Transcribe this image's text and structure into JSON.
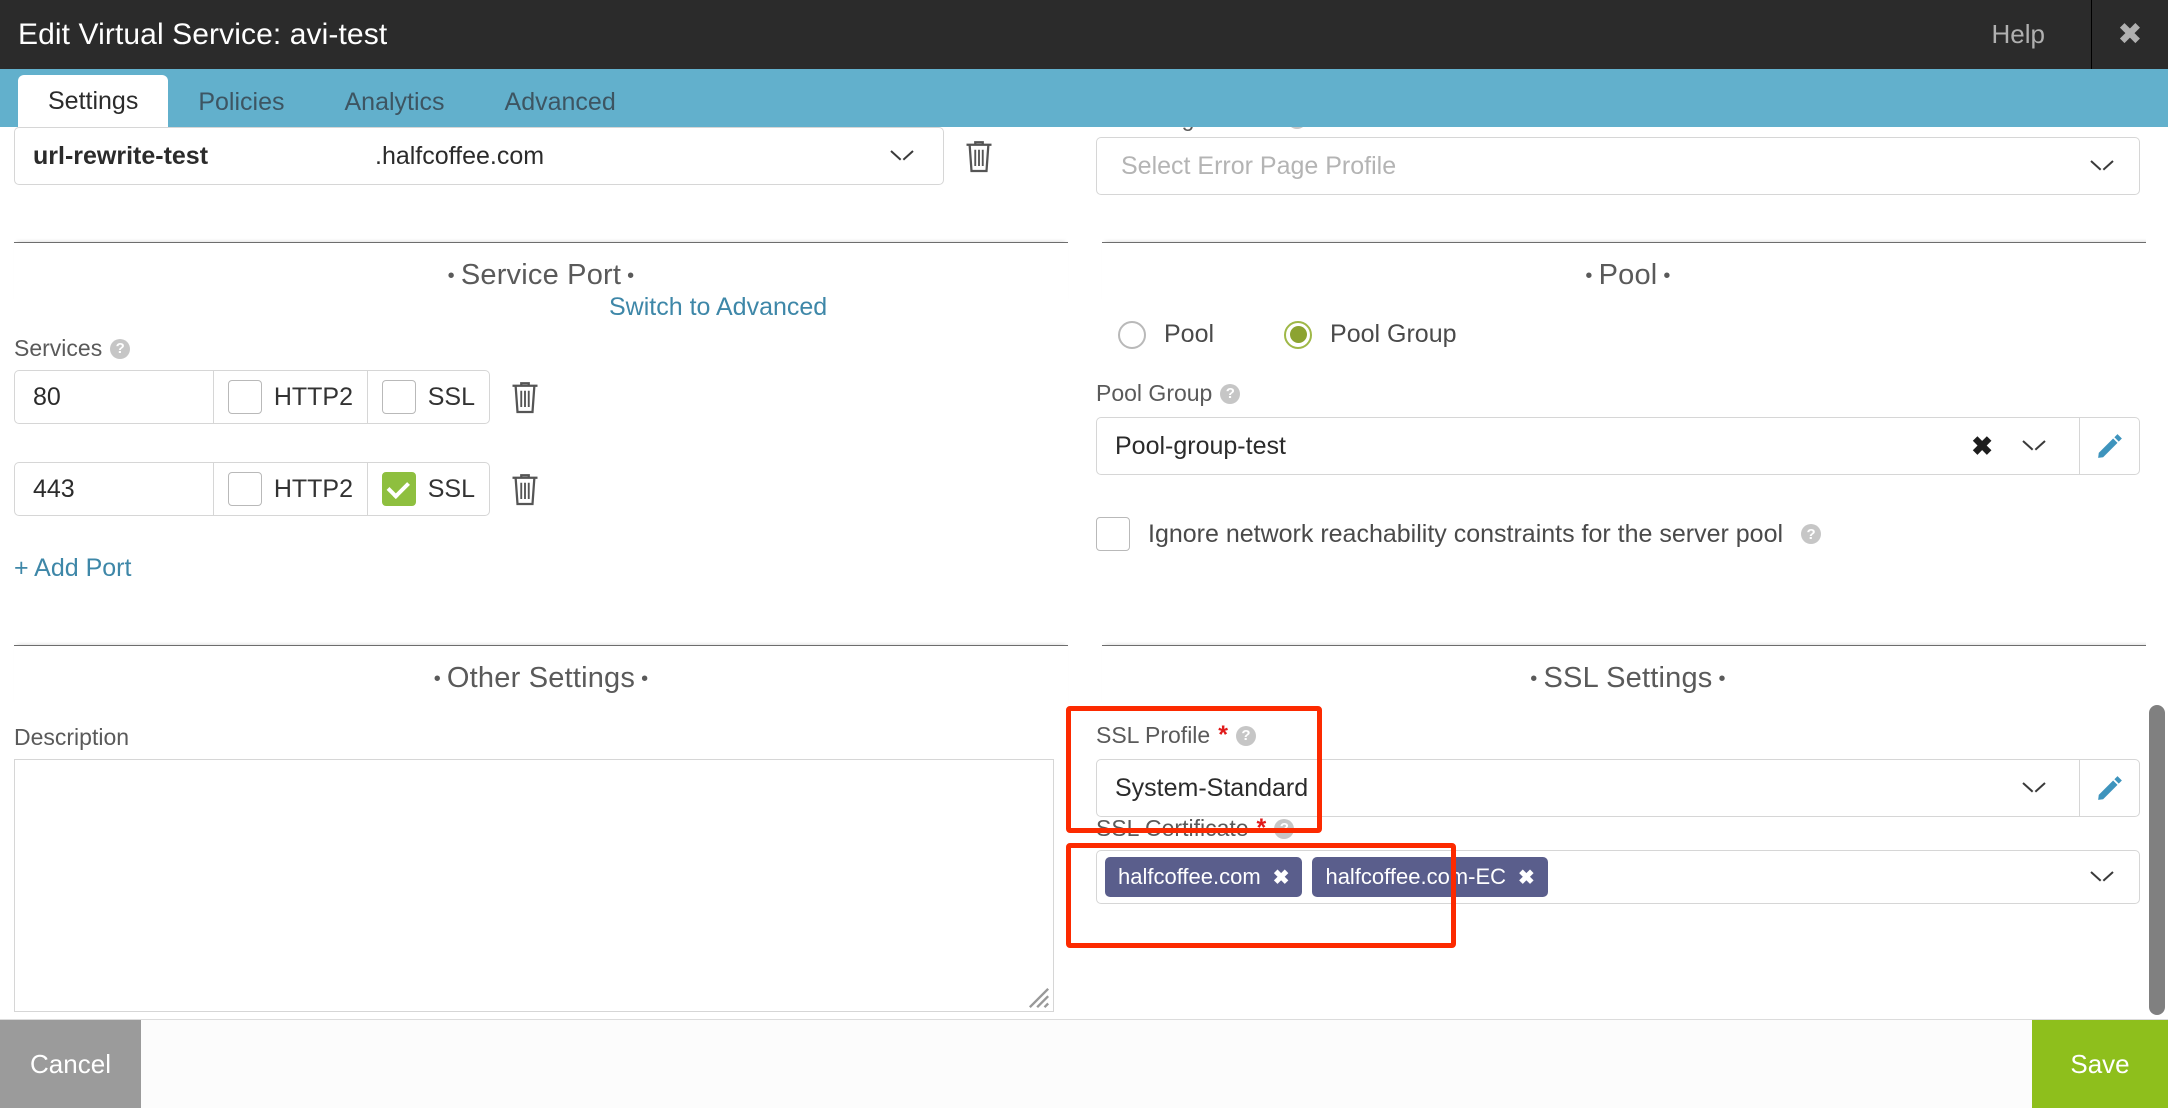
{
  "window": {
    "title": "Edit Virtual Service: avi-test",
    "help_label": "Help",
    "close_icon": "close-icon"
  },
  "tabs": [
    {
      "label": "Settings",
      "active": true
    },
    {
      "label": "Policies",
      "active": false
    },
    {
      "label": "Analytics",
      "active": false
    },
    {
      "label": "Advanced",
      "active": false
    }
  ],
  "left": {
    "vsvip_row": {
      "name_value": "url-rewrite-test",
      "domain_value": ".halfcoffee.com",
      "dropdown_icon": "chevron-down-icon",
      "delete_icon": "trash-icon"
    },
    "service_port": {
      "section_title": "Service Port",
      "switch_link": "Switch to Advanced",
      "services_label": "Services",
      "http2_label": "HTTP2",
      "ssl_label": "SSL",
      "rows": [
        {
          "port": "80",
          "http2_checked": false,
          "ssl_checked": false
        },
        {
          "port": "443",
          "http2_checked": false,
          "ssl_checked": true
        }
      ],
      "add_port_label": "+ Add Port"
    },
    "other_settings": {
      "section_title": "Other Settings",
      "description_label": "Description",
      "description_value": "",
      "description_placeholder": ""
    }
  },
  "right": {
    "error_page_profile": {
      "label": "Error Page Profile",
      "placeholder": "Select Error Page Profile",
      "value": ""
    },
    "pool": {
      "section_title": "Pool",
      "radios": [
        {
          "label": "Pool",
          "selected": false
        },
        {
          "label": "Pool Group",
          "selected": true
        }
      ],
      "pool_group_label": "Pool Group",
      "pool_group_value": "Pool-group-test",
      "clear_icon": "clear-x-icon",
      "dropdown_icon": "chevron-down-icon",
      "edit_icon": "pencil-icon",
      "ignore_checkbox_label": "Ignore network reachability constraints for the server pool",
      "ignore_checkbox_checked": false
    },
    "ssl_settings": {
      "section_title": "SSL Settings",
      "ssl_profile_label": "SSL Profile",
      "ssl_profile_required": "*",
      "ssl_profile_value": "System-Standard",
      "ssl_certificate_label": "SSL Certificate",
      "ssl_certificate_required": "*",
      "ssl_certificate_chips": [
        {
          "label": "halfcoffee.com"
        },
        {
          "label": "halfcoffee.com-EC"
        }
      ]
    }
  },
  "footer": {
    "cancel_label": "Cancel",
    "save_label": "Save"
  },
  "colors": {
    "titlebar": "#2b2b2b",
    "tabbar": "#62b0cc",
    "link": "#3e87a8",
    "checkbox_checked": "#8ebf3f",
    "radio_selected": "#8ca331",
    "chip": "#5a5e8c",
    "highlight": "#fc2a00",
    "save": "#8ebf1c",
    "cancel": "#9b9b9b",
    "required_star": "#e01b1b"
  }
}
